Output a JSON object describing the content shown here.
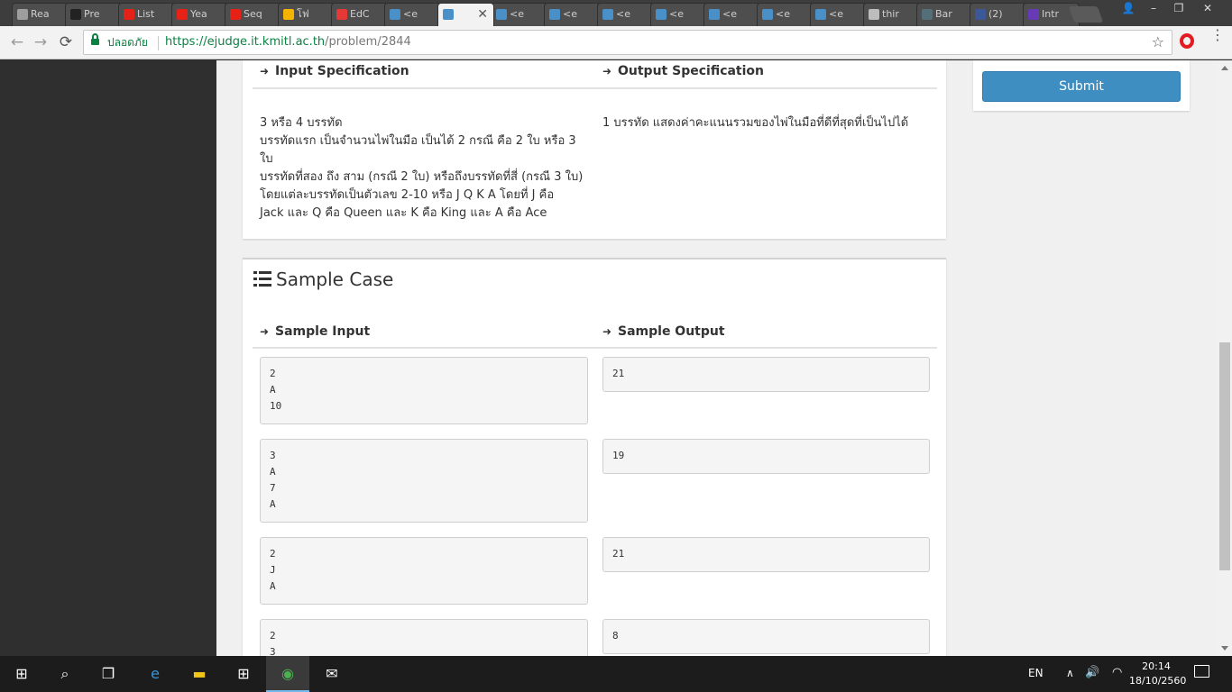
{
  "browser": {
    "tabs": [
      {
        "label": "Rea",
        "icon": "reading-list-icon",
        "color": "#9e9e9e"
      },
      {
        "label": "Pre",
        "icon": "github-icon",
        "color": "#222222"
      },
      {
        "label": "List",
        "icon": "youtube-icon",
        "color": "#e62117"
      },
      {
        "label": "Yea",
        "icon": "youtube-icon",
        "color": "#e62117"
      },
      {
        "label": "Seq",
        "icon": "youtube-icon",
        "color": "#e62117"
      },
      {
        "label": "โฟ",
        "icon": "google-drive-icon",
        "color": "#f4b400"
      },
      {
        "label": "EdC",
        "icon": "edcaster-icon",
        "color": "#e53935"
      },
      {
        "label": "<e",
        "icon": "ejudge-icon",
        "color": "#4a90c8"
      },
      {
        "label": "",
        "icon": "ejudge-icon",
        "color": "#4a90c8",
        "active": true
      },
      {
        "label": "<e",
        "icon": "ejudge-icon",
        "color": "#4a90c8"
      },
      {
        "label": "<e",
        "icon": "ejudge-icon",
        "color": "#4a90c8"
      },
      {
        "label": "<e",
        "icon": "ejudge-icon",
        "color": "#4a90c8"
      },
      {
        "label": "<e",
        "icon": "ejudge-icon",
        "color": "#4a90c8"
      },
      {
        "label": "<e",
        "icon": "ejudge-icon",
        "color": "#4a90c8"
      },
      {
        "label": "<e",
        "icon": "ejudge-icon",
        "color": "#4a90c8"
      },
      {
        "label": "<e",
        "icon": "ejudge-icon",
        "color": "#4a90c8"
      },
      {
        "label": "thir",
        "icon": "document-icon",
        "color": "#bdbdbd"
      },
      {
        "label": "Bar",
        "icon": "bar-app-icon",
        "color": "#546e7a"
      },
      {
        "label": "(2)",
        "icon": "facebook-icon",
        "color": "#3b5998"
      },
      {
        "label": "Intr",
        "icon": "forms-icon",
        "color": "#673ab7"
      }
    ],
    "close_tab_glyph": "✕",
    "window_controls": {
      "profile": "👤",
      "minimize": "–",
      "restore": "❐",
      "close": "✕"
    },
    "nav": {
      "back": "←",
      "forward": "→",
      "reload": "⟳"
    },
    "secure_label": "ปลอดภัย",
    "url_host": "https://ejudge.it.kmitl.ac.th",
    "url_path": "/problem/2844",
    "star": "☆",
    "menu": "⋮"
  },
  "page": {
    "input_spec": {
      "heading": "Input Specification",
      "lines": [
        "3 หรือ 4 บรรทัด",
        "บรรทัดแรก เป็นจำนวนไพ่ในมือ เป็นได้ 2 กรณี คือ 2 ใบ หรือ 3",
        "ใบ",
        "บรรทัดที่สอง ถึง สาม (กรณี 2 ใบ) หรือถึงบรรทัดที่สี่ (กรณี 3 ใบ)",
        "โดยแต่ละบรรทัดเป็นตัวเลข 2-10 หรือ J Q K A โดยที่ J คือ",
        "Jack และ Q คือ Queen และ K คือ King และ A คือ Ace"
      ]
    },
    "output_spec": {
      "heading": "Output Specification",
      "text": "1 บรรทัด แสดงค่าคะแนนรวมของไพ่ในมือที่ดีที่สุดที่เป็นไปได้"
    },
    "sample_case": {
      "title": "Sample Case",
      "input_heading": "Sample Input",
      "output_heading": "Sample Output",
      "cases": [
        {
          "input": "2\nA\n10",
          "output": "21"
        },
        {
          "input": "3\nA\n7\nA",
          "output": "19"
        },
        {
          "input": "2\nJ\nA",
          "output": "21"
        },
        {
          "input": "2\n3",
          "output": "8"
        }
      ]
    },
    "submit_label": "Submit"
  },
  "taskbar": {
    "start": "⊞",
    "search": "⌕",
    "task_view": "❐",
    "apps": [
      {
        "name": "edge",
        "glyph": "e",
        "color": "#3a96dd"
      },
      {
        "name": "file-explorer",
        "glyph": "▬",
        "color": "#f0c419"
      },
      {
        "name": "store",
        "glyph": "⊞",
        "color": "#ffffff"
      },
      {
        "name": "chrome",
        "glyph": "◉",
        "color": "#4caf50",
        "active": true
      },
      {
        "name": "mail",
        "glyph": "✉",
        "color": "#ffffff"
      }
    ],
    "language": "EN",
    "tray_up": "∧",
    "volume": "🔊",
    "network": "◠",
    "time": "20:14",
    "date": "18/10/2560"
  }
}
